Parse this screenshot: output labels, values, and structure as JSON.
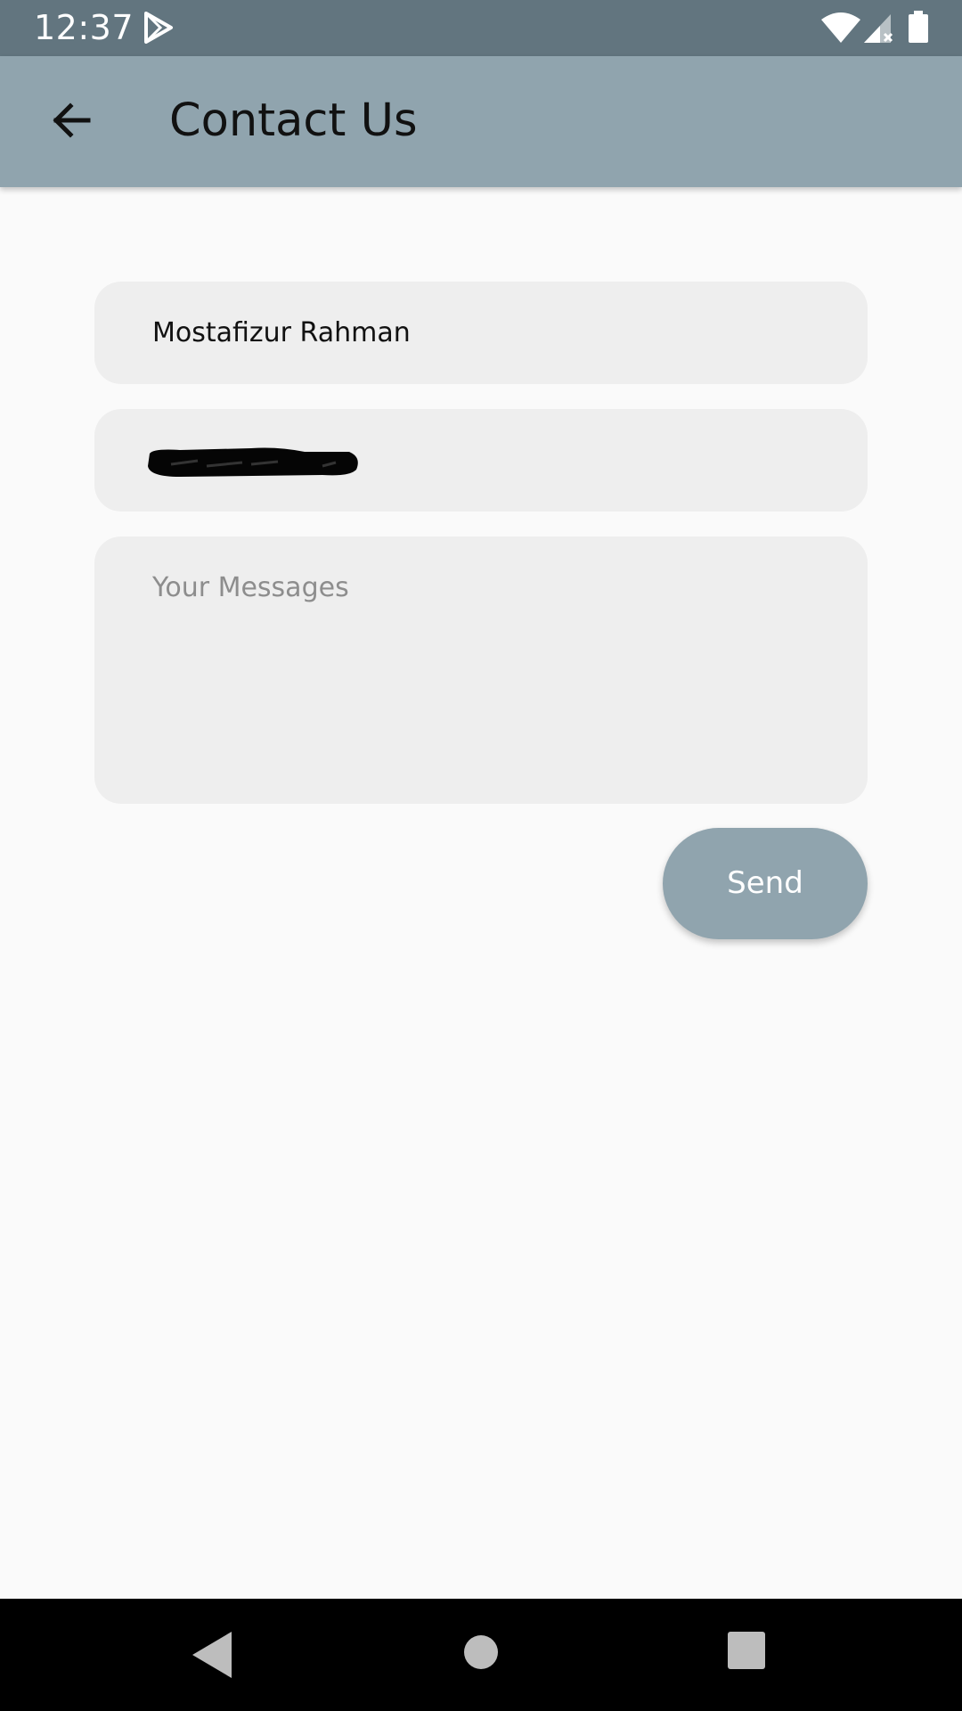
{
  "status_bar": {
    "time": "12:37",
    "icons": [
      "play-store-icon",
      "wifi-icon",
      "signal-icon",
      "battery-icon"
    ]
  },
  "app_bar": {
    "title": "Contact Us",
    "back_icon": "arrow-left-icon",
    "background_color": "#90a4ae"
  },
  "form": {
    "name": {
      "value": "Mostafizur Rahman"
    },
    "email": {
      "value": "",
      "redacted": true
    },
    "message": {
      "value": "",
      "placeholder": "Your Messages"
    },
    "send_label": "Send"
  },
  "colors": {
    "status_bar": "#62757f",
    "accent": "#90a4ae",
    "field_background": "#eeeeee",
    "page_background": "#fafafa"
  },
  "nav_bar": {
    "icons": [
      "nav-back-icon",
      "nav-home-icon",
      "nav-recents-icon"
    ]
  }
}
